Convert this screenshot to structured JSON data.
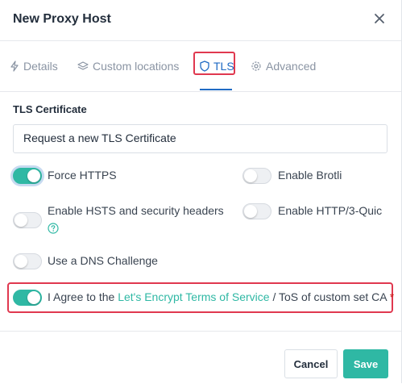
{
  "modal": {
    "title": "New Proxy Host"
  },
  "tabs": [
    {
      "label": "Details",
      "icon": "bolt-icon"
    },
    {
      "label": "Custom locations",
      "icon": "layers-icon"
    },
    {
      "label": "TLS",
      "icon": "shield-icon",
      "active": true
    },
    {
      "label": "Advanced",
      "icon": "gear-icon"
    }
  ],
  "tls": {
    "section_label": "TLS Certificate",
    "certificate_select": "Request a new TLS Certificate",
    "toggles": {
      "force_https": {
        "label": "Force HTTPS",
        "on": true
      },
      "enable_brotli": {
        "label": "Enable Brotli",
        "on": false
      },
      "hsts": {
        "label": "Enable HSTS and security headers",
        "on": false
      },
      "http3": {
        "label": "Enable HTTP/3-Quic",
        "on": false
      },
      "dns_challenge": {
        "label": "Use a DNS Challenge",
        "on": false
      },
      "agree": {
        "on": true,
        "prefix": "I Agree to the",
        "link": "Let's Encrypt Terms of Service",
        "suffix": "/ ToS of custom set CA",
        "required_mark": "*"
      }
    }
  },
  "footer": {
    "cancel_label": "Cancel",
    "save_label": "Save"
  },
  "colors": {
    "accent": "#2fb8a4",
    "tab_active": "#206bc4",
    "highlight_border": "#e0384f"
  }
}
